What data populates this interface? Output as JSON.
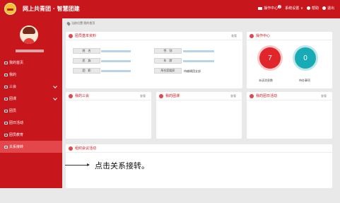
{
  "header": {
    "title": "网上共青团 · 智慧团建",
    "message_label": "操作中心",
    "message_badge": "2",
    "settings_label": "系统设置",
    "help_label": "帮助",
    "logout_label": "退出",
    "bg_color": "#c8161d"
  },
  "sidebar": {
    "items": [
      {
        "label": "我的首页",
        "icon": "home-icon"
      },
      {
        "label": "我的",
        "icon": "user-icon"
      },
      {
        "label": "三会",
        "icon": "meeting-icon",
        "expandable": true
      },
      {
        "label": "团课",
        "icon": "book-icon",
        "expandable": true
      },
      {
        "label": "团员",
        "icon": "member-icon"
      },
      {
        "label": "团日活动",
        "icon": "flag-icon"
      },
      {
        "label": "团员教育",
        "icon": "education-icon"
      },
      {
        "label": "关系接转",
        "icon": "transfer-icon"
      }
    ]
  },
  "breadcrumb": "当前位置:我的首页",
  "basic_info": {
    "title": "团员基本资料",
    "more": "查看",
    "fields": {
      "name": "姓　名",
      "gender": "性　别",
      "ethnicity": "民　族",
      "age": "年　龄",
      "position": "团　职",
      "org": "所在团组织",
      "org_value": "待编辑团支部"
    }
  },
  "ops_center": {
    "title": "操作中心",
    "unread_count": "7",
    "unread_label": "未读消息数",
    "todo_count": "0",
    "todo_label": "待办事项"
  },
  "cards": {
    "sanhui": {
      "title": "我的三会",
      "more": "查看"
    },
    "tuanke": {
      "title": "我的团课",
      "more": "查看"
    },
    "tuanri": {
      "title": "我的团日活动",
      "more": "查看"
    },
    "meeting": {
      "title": "组织会议活动"
    }
  },
  "annotation": "点击关系接转。"
}
